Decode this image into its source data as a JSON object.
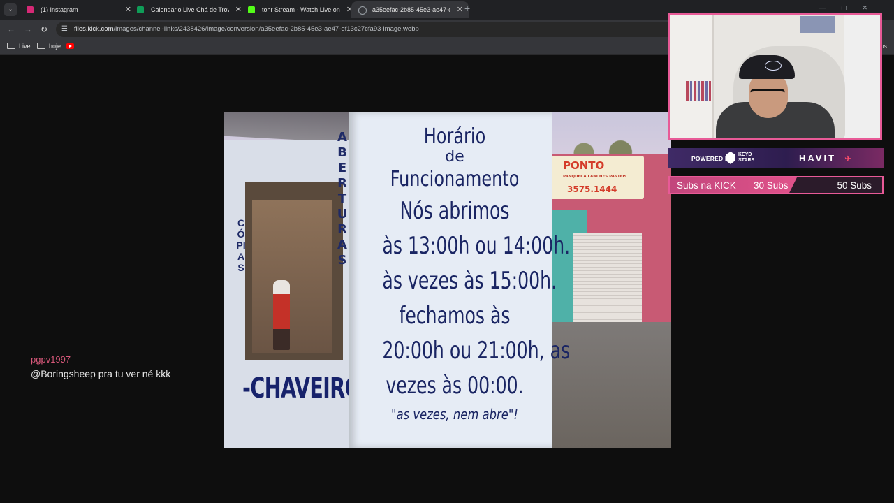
{
  "browser": {
    "tabs": [
      {
        "title": "(1) Instagram",
        "favicon": "instagram-icon",
        "color": "#d62976"
      },
      {
        "title": "Calendário Live Chá de Trovão",
        "favicon": "sheets-icon",
        "color": "#0f9d58"
      },
      {
        "title": "tohr Stream - Watch Live on Kick",
        "favicon": "kick-icon",
        "color": "#53fc18"
      },
      {
        "title": "a35eefac-2b85-45e3-ae47-ef13c27cfa93-image.webp",
        "favicon": "globe-icon",
        "color": "#9aa0a6"
      }
    ],
    "url_host": "files.kick.com",
    "url_path": "/images/channel-links/2438426/image/conversion/a35eefac-2b85-45e3-ae47-ef13c27cfa93-image.webp",
    "bookmarks": [
      {
        "label": "Live",
        "icon": "folder-icon"
      },
      {
        "label": "hoje",
        "icon": "folder-icon"
      },
      {
        "label": "",
        "icon": "youtube-icon"
      }
    ],
    "overflow_label": "os"
  },
  "photo": {
    "front_sign": {
      "line1": "Horário",
      "line2": "de",
      "line3": "Funcionamento",
      "line4": "Nós abrimos",
      "line5": "às 13:00h ou 14:00h.",
      "line6": "às vezes às 15:00h.",
      "line7": "fechamos às",
      "line8": "20:00h ou 21:00h, as",
      "line9": "vezes às 00:00.",
      "line10": "\"as vezes, nem abre\"!"
    },
    "side_text": "ABERTURAS",
    "copias_text": "CÓPIAS",
    "chaveiro_text": "-CHAVEIRO-",
    "shop_sign": {
      "title": "PONTO",
      "subtitle": "PANQUECA LANCHES PASTEIS",
      "phone": "3575.1444"
    }
  },
  "chat": {
    "username": "pgpv1997",
    "message": "@Boringsheep pra tu ver né kkk",
    "username_color": "#d8587a"
  },
  "sponsor": {
    "powered_by": "POWERED BY",
    "keyd_line1": "KEYD",
    "keyd_line2": "STARS",
    "partner": "HAVIT"
  },
  "subs_goal": {
    "label": "Subs na KICK",
    "current": "30 Subs",
    "goal": "50 Subs",
    "progress": 0.6,
    "accent": "#e85a97"
  }
}
